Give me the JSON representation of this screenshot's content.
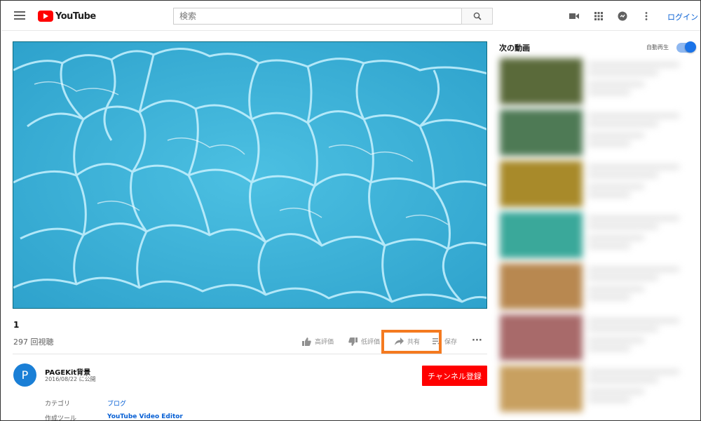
{
  "header": {
    "logo_text": "YouTube",
    "search_placeholder": "検索",
    "login_label": "ログイン"
  },
  "video": {
    "title": "1",
    "views": "297 回視聴"
  },
  "actions": {
    "like_label": "高評価",
    "dislike_label": "低評価",
    "share_label": "共有",
    "save_label": "保存",
    "more_label": "···"
  },
  "channel": {
    "avatar_letter": "P",
    "name": "PAGEKit背景",
    "published": "2016/08/22 に公開",
    "subscribe_label": "チャンネル登録"
  },
  "metadata": [
    {
      "label": "カテゴリ",
      "value": "ブログ"
    },
    {
      "label": "作成ツール",
      "value": "YouTube Video Editor"
    }
  ],
  "sidebar": {
    "up_next_label": "次の動画",
    "autoplay_label": "自動再生",
    "autoplay_on": true,
    "recommendations": [
      {
        "thumb_color": "#5a6a3a"
      },
      {
        "thumb_color": "#4e7a55"
      },
      {
        "thumb_color": "#a88a2a"
      },
      {
        "thumb_color": "#3aa89a"
      },
      {
        "thumb_color": "#b88850"
      },
      {
        "thumb_color": "#a86a6a"
      },
      {
        "thumb_color": "#c8a060"
      }
    ]
  },
  "colors": {
    "accent": "#ff0000",
    "link": "#065fd4",
    "highlight": "#f47a20",
    "water": "#3fb3d8"
  }
}
